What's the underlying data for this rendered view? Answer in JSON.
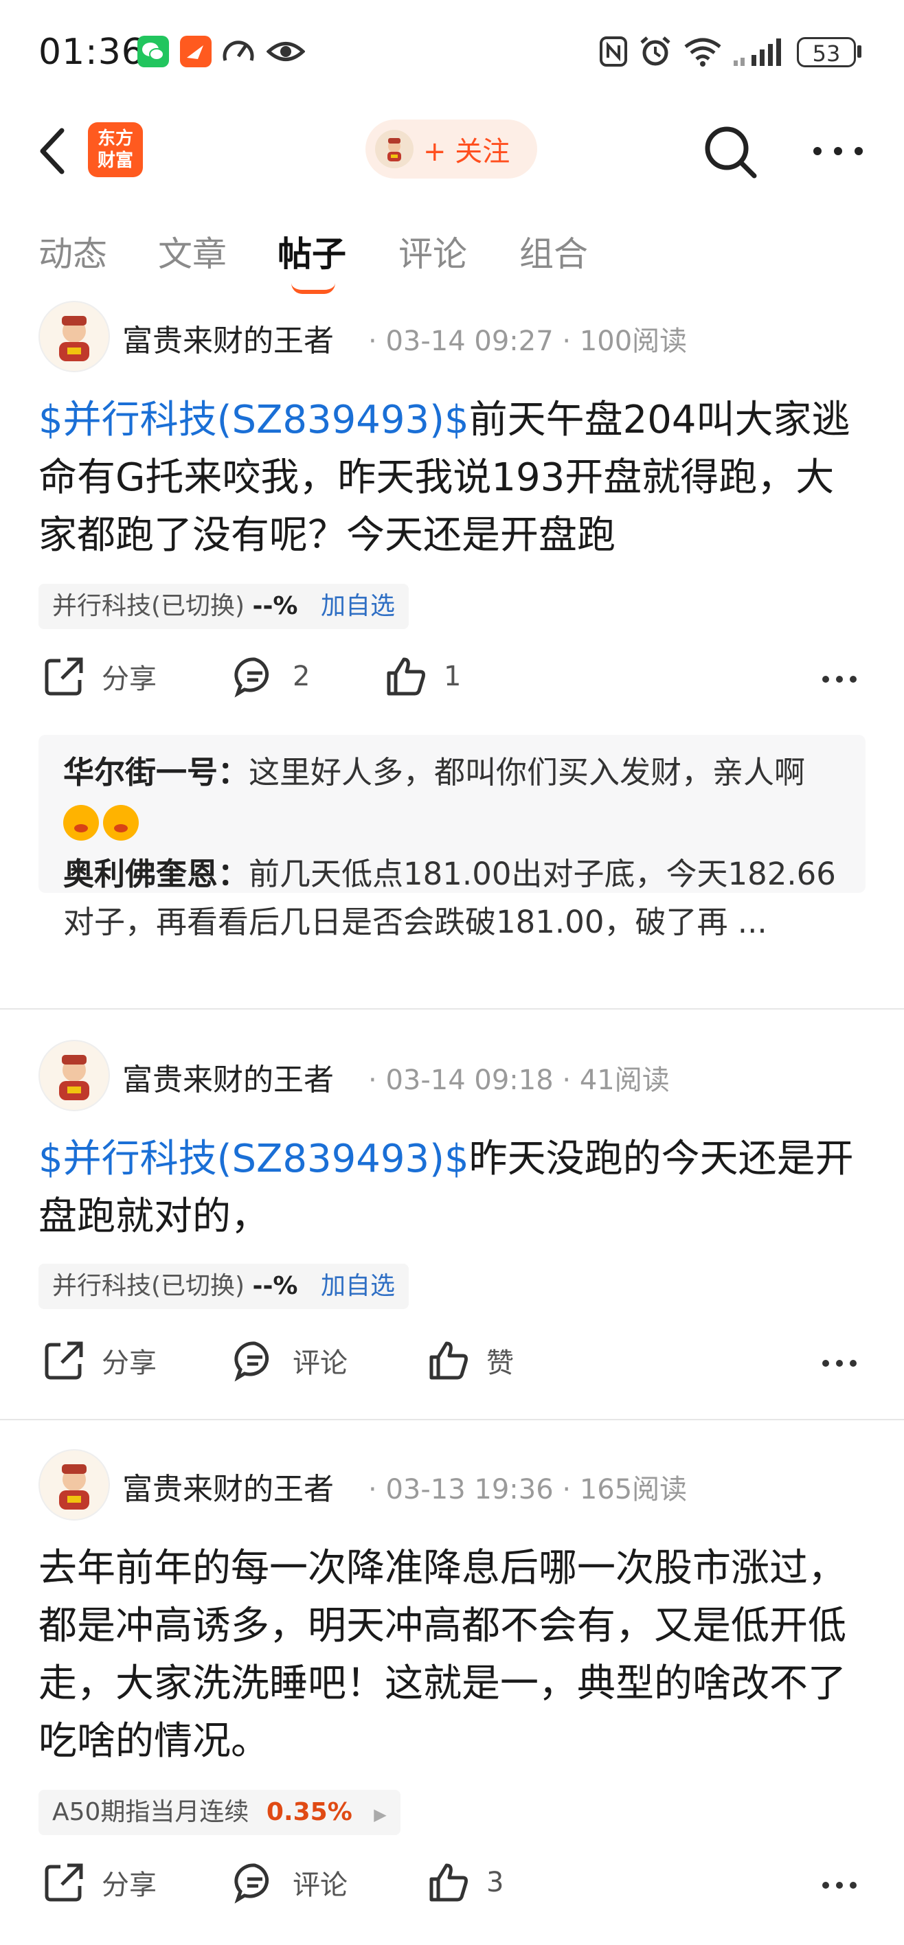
{
  "status": {
    "time": "01:36",
    "battery": "53"
  },
  "header": {
    "logo_text_1": "东方",
    "logo_text_2": "财富",
    "follow_label": "+ 关注"
  },
  "tabs": [
    {
      "label": "动态"
    },
    {
      "label": "文章"
    },
    {
      "label": "帖子"
    },
    {
      "label": "评论"
    },
    {
      "label": "组合"
    }
  ],
  "posts": [
    {
      "author": "富贵来财的王者",
      "time": "03-14 09:27",
      "reads": "100阅读",
      "link": "$并行科技(SZ839493)$",
      "text": "前天午盘204叫大家逃命有G托来咬我，昨天我说193开盘就得跑，大家都跑了没有呢？今天还是开盘跑",
      "tag_name": "并行科技(已切换)",
      "tag_value": "--%",
      "tag_action": "加自选",
      "share": "分享",
      "comment": "2",
      "like": "1",
      "comments": [
        {
          "user": "华尔街一号：",
          "text": "这里好人多，都叫你们买入发财，亲人啊"
        },
        {
          "user": "奥利佛奎恩：",
          "text": "前几天低点181.00出对子底，今天182.66对子，再看看后几日是否会跌破181.00，破了再 ..."
        }
      ]
    },
    {
      "author": "富贵来财的王者",
      "time": "03-14 09:18",
      "reads": "41阅读",
      "link": "$并行科技(SZ839493)$",
      "text": "昨天没跑的今天还是开盘跑就对的，",
      "tag_name": "并行科技(已切换)",
      "tag_value": "--%",
      "tag_action": "加自选",
      "share": "分享",
      "comment": "评论",
      "like": "赞"
    },
    {
      "author": "富贵来财的王者",
      "time": "03-13 19:36",
      "reads": "165阅读",
      "text": "去年前年的每一次降准降息后哪一次股市涨过，都是冲高诱多，明天冲高都不会有，又是低开低走，大家洗洗睡吧！这就是一，典型的啥改不了吃啥的情况。",
      "tag_name": "A50期指当月连续",
      "tag_value": "0.35%",
      "share": "分享",
      "comment": "评论",
      "like": "3"
    }
  ],
  "colors": {
    "accent": "#ff5a1f",
    "link": "#1a6fd6",
    "up": "#e04a14"
  }
}
